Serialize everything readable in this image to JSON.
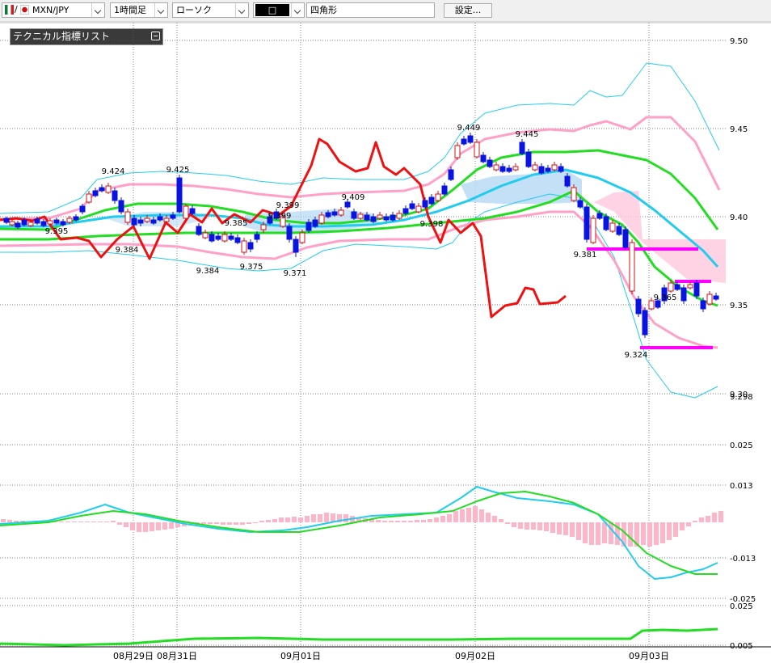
{
  "toolbar": {
    "pair": "MXN/JPY",
    "timeframe": "1時間足",
    "chart_style": "ローソク",
    "draw_tool": "□",
    "shape": "四角形",
    "settings_button": "設定..."
  },
  "indicator_panel": {
    "label": "テクニカル指標リスト"
  },
  "colors": {
    "up_candle": "#d01010",
    "down_candle": "#0a14e0",
    "line_red": "#ee1111",
    "bollinger_mid": "#22dd22",
    "bollinger_2sigma": "#ffa0c8",
    "bollinger_3sigma": "#44e8f0",
    "ma_cyan": "#22ccee",
    "cloud": "#b4d8f4",
    "cloud_pink": "#ffc8dc",
    "box_magenta": "#ff00ff",
    "macd_hist": "#ffb4c8"
  },
  "chart_data": [
    {
      "type": "line",
      "ylim": [
        9.298,
        9.5
      ],
      "yticks": [
        "9.50",
        "9.45",
        "9.40",
        "9.35",
        "9.30"
      ],
      "ylow_label": "9.298",
      "xticks": [
        "08月29日",
        "08月31日",
        "09月01日",
        "09月02日",
        "09月03日"
      ],
      "annotations": [
        "9.395",
        "9.424",
        "9.425",
        "9.384",
        "9.385",
        "9.384",
        "9.375",
        "9.399",
        "9.399",
        "9.371",
        "9.409",
        "9.398",
        "9.449",
        "9.445",
        "9.381",
        "9.324",
        "9.365"
      ],
      "series": []
    },
    {
      "type": "line",
      "yticks": [
        "0.025",
        "0.013",
        "-0.013",
        "-0.025"
      ],
      "series": []
    },
    {
      "type": "line",
      "yticks": [
        "0.025",
        "0.005"
      ],
      "series": []
    }
  ]
}
